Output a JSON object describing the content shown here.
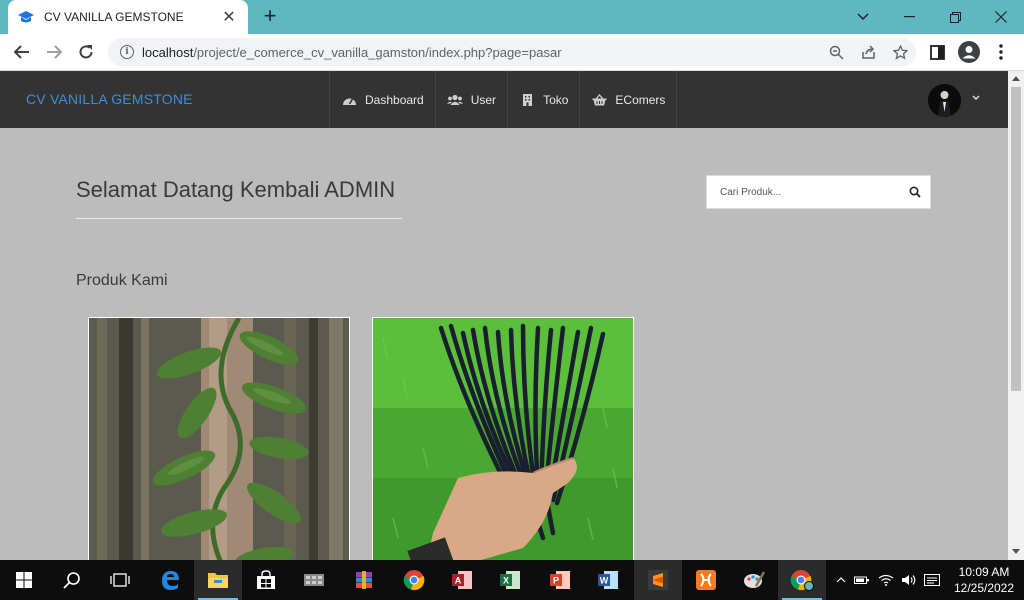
{
  "browser": {
    "tab_title": "CV VANILLA GEMSTONE",
    "url_host": "localhost",
    "url_path": "/project/e_comerce_cv_vanilla_gamston/index.php?page=pasar"
  },
  "app": {
    "brand": "CV VANILLA GEMSTONE",
    "nav": [
      {
        "label": "Dashboard",
        "icon": "dashboard-icon"
      },
      {
        "label": "User",
        "icon": "users-icon"
      },
      {
        "label": "Toko",
        "icon": "building-icon"
      },
      {
        "label": "EComers",
        "icon": "basket-icon"
      }
    ]
  },
  "main": {
    "welcome": "Selamat Datang Kembali ADMIN",
    "search_placeholder": "Cari Produk...",
    "section_title": "Produk Kami",
    "products": [
      {
        "image": "vanilla-vine-photo"
      },
      {
        "image": "vanilla-pods-photo"
      }
    ]
  },
  "taskbar": {
    "time": "10:09 AM",
    "date": "12/25/2022"
  },
  "colors": {
    "tab_strip": "#5fb8c0",
    "appbar": "#333333",
    "brand": "#3d8fd6",
    "page_bg": "#bcbcbc"
  }
}
